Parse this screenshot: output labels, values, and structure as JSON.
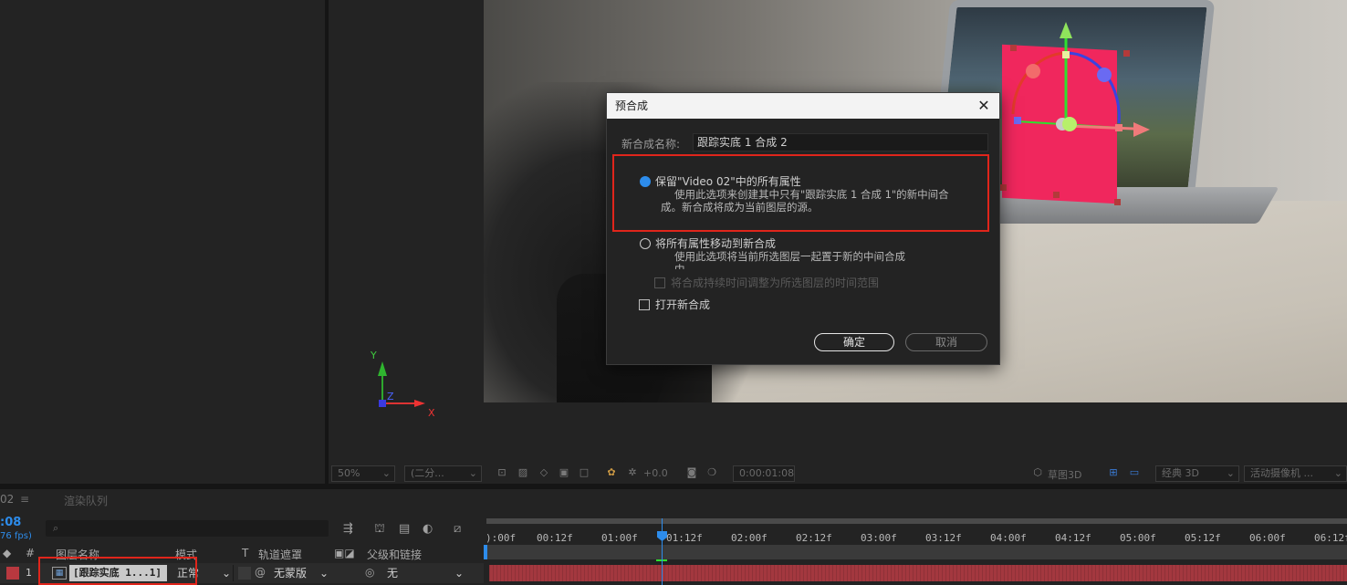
{
  "dialog": {
    "title": "预合成",
    "close_glyph": "✕",
    "name_label": "新合成名称:",
    "name_value": "跟踪实底 1 合成 2",
    "option1_title": "保留\"Video 02\"中的所有属性",
    "option1_desc_line1": "使用此选项来创建其中只有\"跟踪实底 1 合成 1\"的新中间合",
    "option1_desc_line2": "成。新合成将成为当前图层的源。",
    "option2_title": "将所有属性移动到新合成",
    "option2_desc_line1": "使用此选项将当前所选图层一起置于新的中间合成",
    "option2_desc_line2": "中。",
    "adjust_duration_label": "将合成持续时间调整为所选图层的时间范围",
    "open_new_comp_label": "打开新合成",
    "ok_label": "确定",
    "cancel_label": "取消"
  },
  "axis_widget": {
    "y": "Y",
    "z": "Z",
    "x": "X"
  },
  "viewer_toolbar": {
    "zoom": "50%",
    "resolution": "(二分...",
    "exposure": "+0.0",
    "timecode": "0:00:01:08",
    "draft3d": "草图3D",
    "renderer": "经典 3D",
    "camera": "活动摄像机 ..."
  },
  "timeline": {
    "tab_comp": "02",
    "tab_render": "渲染队列",
    "time": ":08",
    "fps": "76 fps)",
    "search_glyph": "⌕",
    "col_hash": "#",
    "col_layer_name": "图层名称",
    "col_mode": "模式",
    "col_t": "T",
    "col_trkmat": "轨道遮罩",
    "col_parent": "父级和链接",
    "layer": {
      "index": "1",
      "name": "[跟踪实底 1...1]",
      "mode": "正常",
      "trkmat": "无蒙版",
      "parent": "无"
    },
    "ruler_labels": [
      "):00f",
      "00:12f",
      "01:00f",
      "01:12f",
      "02:00f",
      "02:12f",
      "03:00f",
      "03:12f",
      "04:00f",
      "04:12f",
      "05:00f",
      "05:12f",
      "06:00f",
      "06:12f"
    ]
  },
  "colors": {
    "accent": "#2d8ceb",
    "highlight_red": "#e0251b",
    "solid_pink": "#f0275d",
    "layer_bar": "#a3383f"
  }
}
